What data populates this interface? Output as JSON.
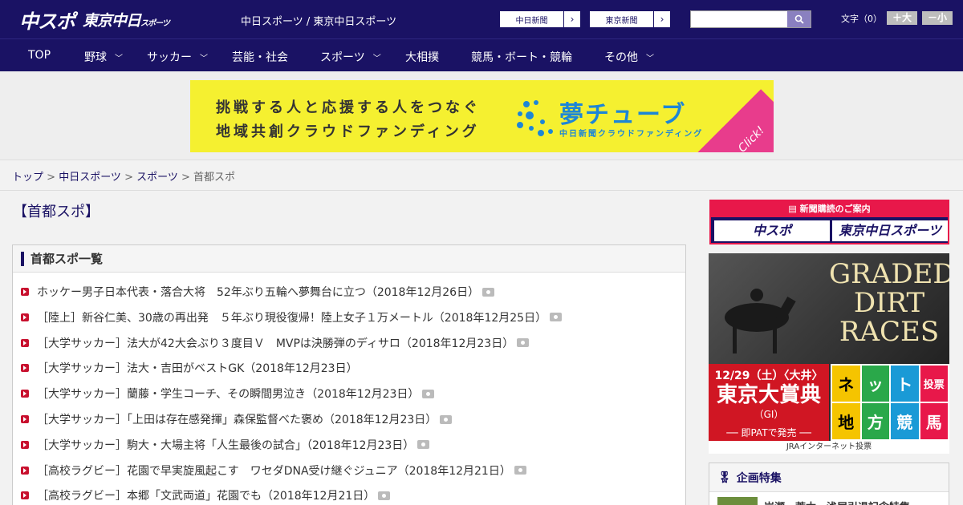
{
  "header": {
    "logo_main": "中スポ",
    "logo_sub": "東京中日",
    "logo_sub_small": "スポーツ",
    "site_title": "中日スポーツ / 東京中日スポーツ",
    "ext_links": [
      "中日新聞",
      "東京新聞"
    ],
    "search_placeholder": "",
    "font_label": "文字（0）",
    "font_plus": "＋大",
    "font_minus": "－小"
  },
  "nav": [
    {
      "label": "TOP",
      "has_menu": false
    },
    {
      "label": "野球",
      "has_menu": true
    },
    {
      "label": "サッカー",
      "has_menu": true
    },
    {
      "label": "芸能・社会",
      "has_menu": false
    },
    {
      "label": "スポーツ",
      "has_menu": true
    },
    {
      "label": "大相撲",
      "has_menu": false
    },
    {
      "label": "競馬・ボート・競輪",
      "has_menu": false
    },
    {
      "label": "その他",
      "has_menu": true
    }
  ],
  "banner": {
    "line1": "挑戦する人と応援する人をつなぐ",
    "line2": "地域共創クラウドファンディング",
    "brand": "夢チューブ",
    "brand_sub": "中日新聞クラウドファンディング",
    "click": "Click!"
  },
  "breadcrumb": {
    "items": [
      "トップ",
      "中日スポーツ",
      "スポーツ"
    ],
    "current": "首都スポ",
    "sep": " > "
  },
  "main": {
    "title": "【首都スポ】",
    "list_title": "首都スポ一覧",
    "articles": [
      "ホッケー男子日本代表・落合大将　52年ぶり五輪へ夢舞台に立つ（2018年12月26日）",
      "［陸上］新谷仁美、30歳の再出発　５年ぶり現役復帰！陸上女子１万メートル（2018年12月25日）",
      "［大学サッカー］法大が42大会ぶり３度目Ｖ　MVPは決勝弾のディサロ（2018年12月23日）",
      "［大学サッカー］法大・吉田がベストGK（2018年12月23日）",
      "［大学サッカー］蘭藤・学生コーチ、その瞬間男泣き（2018年12月23日）",
      "［大学サッカー］「上田は存在感発揮」森保監督べた褒め（2018年12月23日）",
      "［大学サッカー］駒大・大場主将「人生最後の試合」（2018年12月23日）",
      "［高校ラグビー］花園で早実旋風起こす　ワセダDNA受け継ぐジュニア（2018年12月21日）",
      "［高校ラグビー］本郷「文武両道」花園でも（2018年12月21日）"
    ],
    "has_photo": [
      true,
      true,
      true,
      false,
      true,
      true,
      true,
      true,
      true
    ]
  },
  "sidebar": {
    "subscription_title": "新聞購読のご案内",
    "sub_logos": [
      "中スポ",
      "東京中日スポーツ"
    ],
    "ad": {
      "title": "GRADED DIRT RACES",
      "date": "12/29（土）〈大井〉",
      "race": "東京大賞典",
      "grade": "（GI）",
      "pat": "── 即PATで発売 ──",
      "grid": [
        "ネ",
        "ッ",
        "ト",
        "投票",
        "地",
        "方",
        "競",
        "馬"
      ],
      "grid_colors": [
        "#f5c400",
        "#2aa84a",
        "#1a9ad6",
        "#e8184a",
        "#f5c400",
        "#2aa84a",
        "#1a9ad6",
        "#e8184a"
      ],
      "jra": "JRA",
      "footer": "JRAインターネット投票"
    },
    "tokushu_title": "企画特集",
    "tokushu_item": "岩瀬・荒木・浅尾引退記念特集"
  }
}
